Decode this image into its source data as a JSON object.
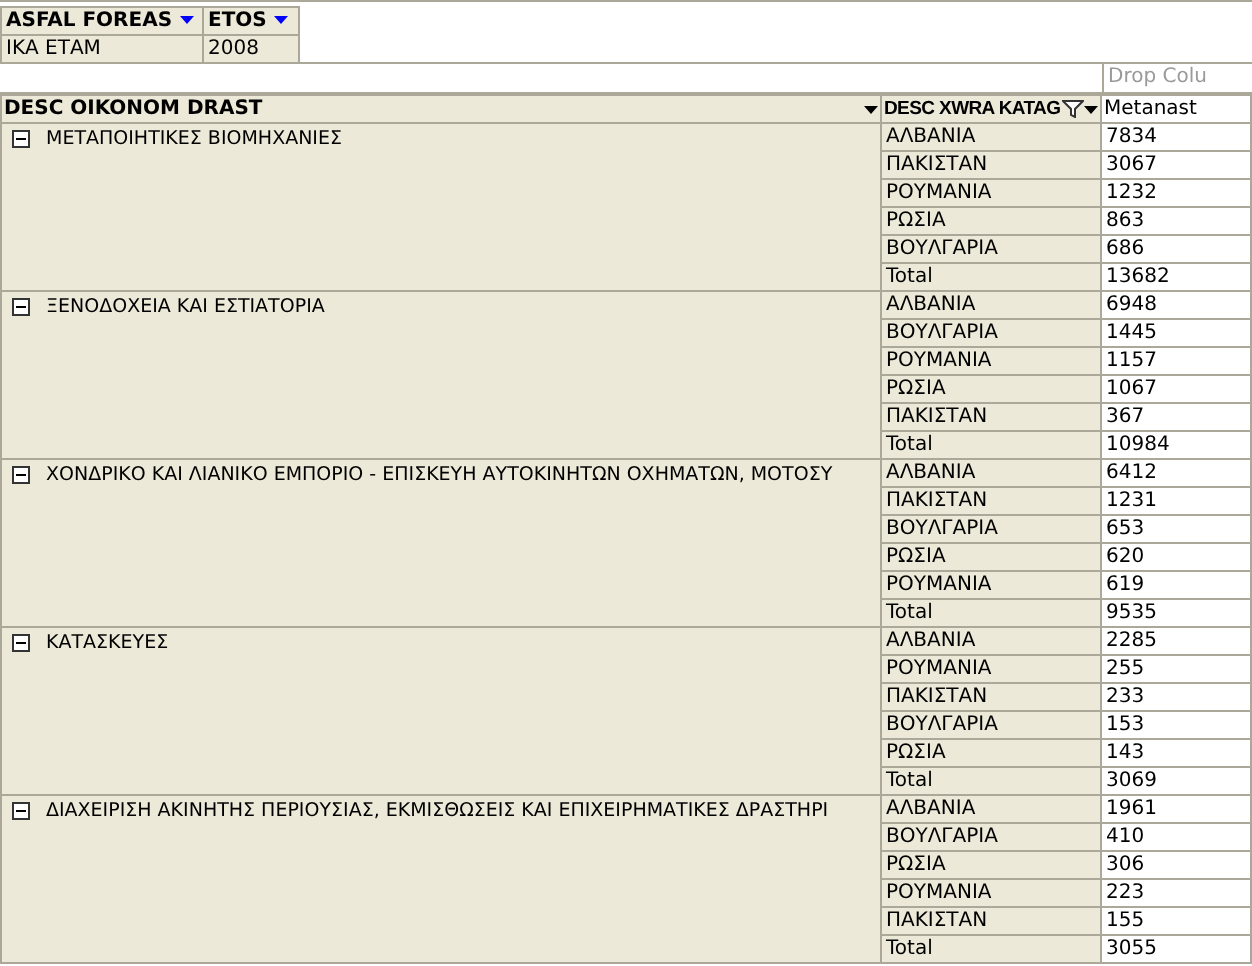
{
  "filters": [
    {
      "label": "ASFAL FOREAS",
      "value": "ΙΚΑ ΕΤΑΜ"
    },
    {
      "label": "ETOS",
      "value": "2008"
    }
  ],
  "drop_zone": "Drop Colu",
  "columns": [
    {
      "label": "DESC OIKONOM DRAST",
      "filtered": false
    },
    {
      "label": "DESC XWRA KATAG",
      "filtered": true
    },
    {
      "label": "Metanast"
    }
  ],
  "groups": [
    {
      "name": "ΜΕΤΑΠΟΙΗΤΙΚΕΣ ΒΙΟΜΗΧΑΝΙΕΣ",
      "expanded": true,
      "rows": [
        {
          "country": "ΑΛΒΑΝΙΑ",
          "value": "7834"
        },
        {
          "country": "ΠΑΚΙΣΤΑΝ",
          "value": "3067"
        },
        {
          "country": "ΡΟΥΜΑΝΙΑ",
          "value": "1232"
        },
        {
          "country": "ΡΩΣΙΑ",
          "value": "863"
        },
        {
          "country": "ΒΟΥΛΓΑΡΙΑ",
          "value": "686"
        }
      ],
      "total_label": "Total",
      "total": "13682"
    },
    {
      "name": "ΞΕΝΟΔΟΧΕΙΑ ΚΑΙ ΕΣΤΙΑΤΟΡΙΑ",
      "expanded": true,
      "rows": [
        {
          "country": "ΑΛΒΑΝΙΑ",
          "value": "6948"
        },
        {
          "country": "ΒΟΥΛΓΑΡΙΑ",
          "value": "1445"
        },
        {
          "country": "ΡΟΥΜΑΝΙΑ",
          "value": "1157"
        },
        {
          "country": "ΡΩΣΙΑ",
          "value": "1067"
        },
        {
          "country": "ΠΑΚΙΣΤΑΝ",
          "value": "367"
        }
      ],
      "total_label": "Total",
      "total": "10984"
    },
    {
      "name": "ΧΟΝΔΡΙΚΟ ΚΑΙ ΛΙΑΝΙΚΟ ΕΜΠΟΡΙΟ - ΕΠΙΣΚΕΥΗ ΑΥΤΟΚΙΝΗΤΩΝ ΟΧΗΜΑΤΩΝ, ΜΟΤΟΣΥ",
      "expanded": true,
      "rows": [
        {
          "country": "ΑΛΒΑΝΙΑ",
          "value": "6412"
        },
        {
          "country": "ΠΑΚΙΣΤΑΝ",
          "value": "1231"
        },
        {
          "country": "ΒΟΥΛΓΑΡΙΑ",
          "value": "653"
        },
        {
          "country": "ΡΩΣΙΑ",
          "value": "620"
        },
        {
          "country": "ΡΟΥΜΑΝΙΑ",
          "value": "619"
        }
      ],
      "total_label": "Total",
      "total": "9535"
    },
    {
      "name": "ΚΑΤΑΣΚΕΥΕΣ",
      "expanded": true,
      "rows": [
        {
          "country": "ΑΛΒΑΝΙΑ",
          "value": "2285"
        },
        {
          "country": "ΡΟΥΜΑΝΙΑ",
          "value": "255"
        },
        {
          "country": "ΠΑΚΙΣΤΑΝ",
          "value": "233"
        },
        {
          "country": "ΒΟΥΛΓΑΡΙΑ",
          "value": "153"
        },
        {
          "country": "ΡΩΣΙΑ",
          "value": "143"
        }
      ],
      "total_label": "Total",
      "total": "3069"
    },
    {
      "name": "ΔΙΑΧΕΙΡΙΣΗ ΑΚΙΝΗΤΗΣ ΠΕΡΙΟΥΣΙΑΣ, ΕΚΜΙΣΘΩΣΕΙΣ ΚΑΙ ΕΠΙΧΕΙΡΗΜΑΤΙΚΕΣ ΔΡΑΣΤΗΡΙ",
      "expanded": true,
      "rows": [
        {
          "country": "ΑΛΒΑΝΙΑ",
          "value": "1961"
        },
        {
          "country": "ΒΟΥΛΓΑΡΙΑ",
          "value": "410"
        },
        {
          "country": "ΡΩΣΙΑ",
          "value": "306"
        },
        {
          "country": "ΡΟΥΜΑΝΙΑ",
          "value": "223"
        },
        {
          "country": "ΠΑΚΙΣΤΑΝ",
          "value": "155"
        }
      ],
      "total_label": "Total",
      "total": "3055"
    }
  ]
}
